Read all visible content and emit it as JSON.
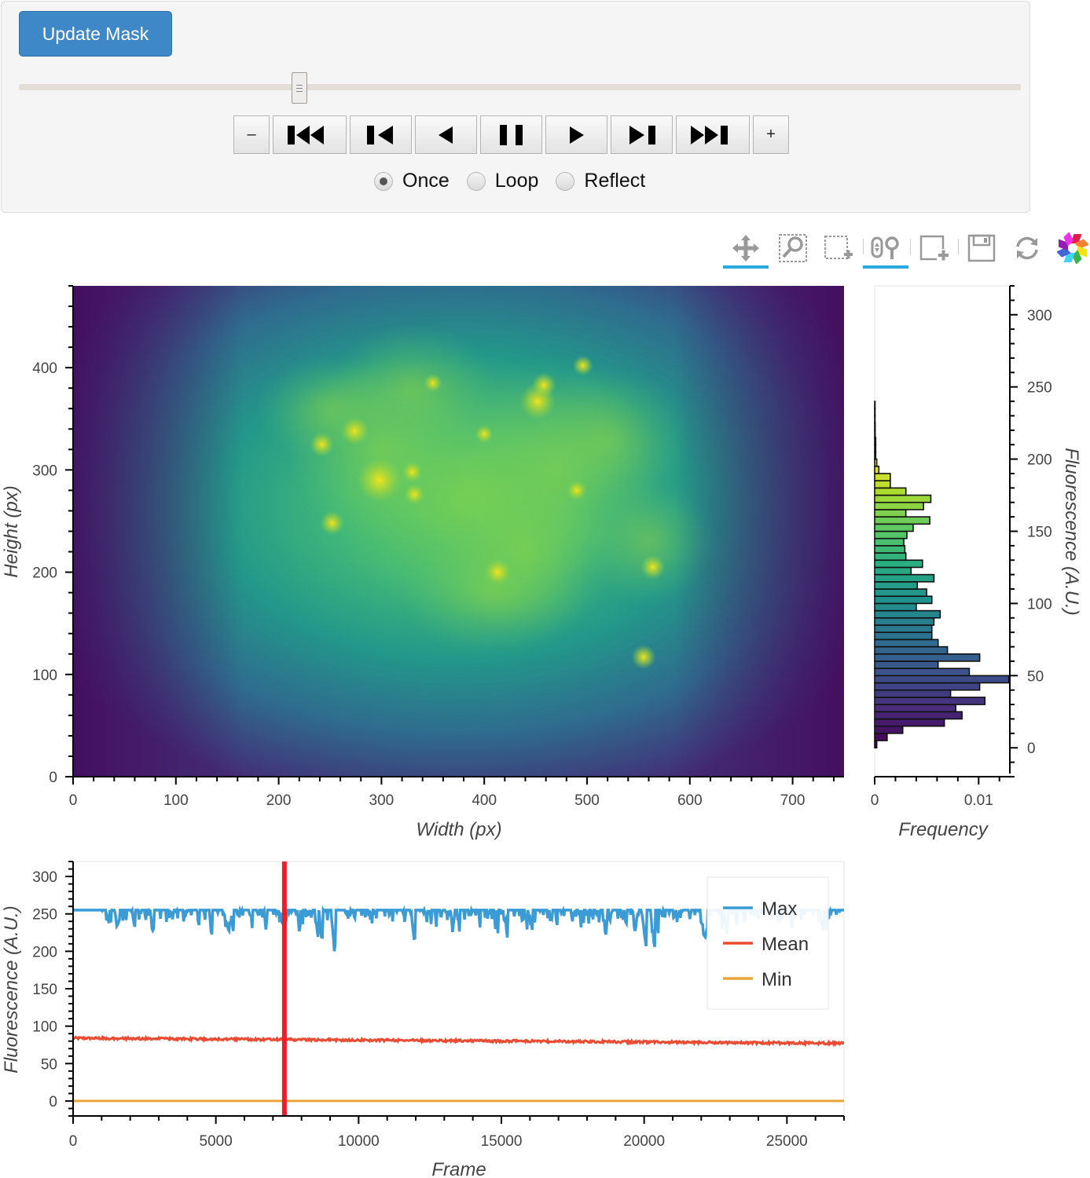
{
  "controls": {
    "update_mask_label": "Update Mask",
    "slider": {
      "value_fraction": 0.28
    },
    "player_buttons": [
      {
        "name": "slower-button",
        "icon": "minus-icon",
        "label": "–"
      },
      {
        "name": "first-frame-button",
        "icon": "skip-to-start-icon"
      },
      {
        "name": "previous-frame-button",
        "icon": "step-backward-icon"
      },
      {
        "name": "play-reverse-button",
        "icon": "play-reverse-icon"
      },
      {
        "name": "pause-button",
        "icon": "pause-icon"
      },
      {
        "name": "play-button",
        "icon": "play-icon"
      },
      {
        "name": "next-frame-button",
        "icon": "step-forward-icon"
      },
      {
        "name": "last-frame-button",
        "icon": "skip-to-end-icon"
      },
      {
        "name": "faster-button",
        "icon": "plus-icon",
        "label": "+"
      }
    ],
    "loop_modes": [
      {
        "label": "Once",
        "selected": true
      },
      {
        "label": "Loop",
        "selected": false
      },
      {
        "label": "Reflect",
        "selected": false
      }
    ]
  },
  "toolbar": {
    "tools": [
      {
        "name": "pan-tool",
        "icon": "move-icon",
        "active": true
      },
      {
        "name": "box-zoom-tool",
        "icon": "box-zoom-icon",
        "active": false
      },
      {
        "name": "box-select-tool",
        "icon": "box-select-icon",
        "active": false
      },
      {
        "name": "wheel-zoom-tool",
        "icon": "wheel-zoom-icon",
        "active": true
      },
      {
        "name": "box-edit-tool",
        "icon": "box-edit-icon",
        "active": false
      },
      {
        "name": "save-tool",
        "icon": "save-icon",
        "active": false
      },
      {
        "name": "reset-tool",
        "icon": "reset-icon",
        "active": false
      },
      {
        "name": "bokeh-logo",
        "icon": "bokeh-logo-icon",
        "active": false
      }
    ]
  },
  "chart_data": [
    {
      "type": "heatmap",
      "title": "",
      "xlabel": "Width (px)",
      "ylabel": "Height (px)",
      "xlim": [
        0,
        750
      ],
      "ylim": [
        0,
        480
      ],
      "xticks": [
        "0",
        "100",
        "200",
        "300",
        "400",
        "500",
        "600",
        "700"
      ],
      "yticks": [
        "0",
        "100",
        "200",
        "300",
        "400"
      ],
      "colormap": "viridis",
      "description": "Fluorescence image of a cell, bright spots concentrated in center"
    },
    {
      "type": "bar",
      "orientation": "horizontal",
      "xlabel": "Frequency",
      "ylabel": "Fluorescence (A.U.)",
      "xlim": [
        0,
        0.013
      ],
      "ylim": [
        -20,
        320
      ],
      "xticks": [
        "0",
        "0.01"
      ],
      "yticks": [
        "0",
        "50",
        "100",
        "150",
        "200",
        "250",
        "300"
      ],
      "bin_width": 5,
      "bin_starts": [
        0,
        5,
        10,
        15,
        20,
        25,
        30,
        35,
        40,
        45,
        50,
        55,
        60,
        65,
        70,
        75,
        80,
        85,
        90,
        95,
        100,
        105,
        110,
        115,
        120,
        125,
        130,
        135,
        140,
        145,
        150,
        155,
        160,
        165,
        170,
        175,
        180,
        185,
        190,
        195,
        200,
        205,
        210,
        215,
        220,
        225,
        230,
        235
      ],
      "values": [
        0.0002,
        0.0012,
        0.0027,
        0.0067,
        0.0084,
        0.0078,
        0.0106,
        0.0073,
        0.0101,
        0.0129,
        0.0091,
        0.0061,
        0.0101,
        0.007,
        0.0061,
        0.0055,
        0.0055,
        0.0057,
        0.0063,
        0.004,
        0.0055,
        0.005,
        0.0041,
        0.0057,
        0.0035,
        0.0046,
        0.003,
        0.0029,
        0.0028,
        0.0031,
        0.0037,
        0.0053,
        0.003,
        0.0047,
        0.0054,
        0.003,
        0.0015,
        0.0015,
        0.0004,
        0.0002,
        0.0001,
        0.0001,
        0.0001,
        5e-05,
        5e-05,
        3e-05,
        2e-05,
        1e-05
      ]
    },
    {
      "type": "line",
      "xlabel": "Frame",
      "ylabel": "Fluorescence (A.U.)",
      "xlim": [
        0,
        27000
      ],
      "ylim": [
        -20,
        320
      ],
      "xticks": [
        "0",
        "5000",
        "10000",
        "15000",
        "20000",
        "25000"
      ],
      "yticks": [
        "0",
        "50",
        "100",
        "150",
        "200",
        "250",
        "300"
      ],
      "current_frame_marker": 7400,
      "legend": {
        "placement": "top-right",
        "entries": [
          "Max",
          "Mean",
          "Min"
        ]
      },
      "series": [
        {
          "name": "Max",
          "color": "#3a9bd5",
          "description": "saturates at 255, fluctuates 190-255",
          "base": 255,
          "min": 190
        },
        {
          "name": "Mean",
          "color": "#ea4b32",
          "description": "about 80, slowly declining from ~84 to ~77",
          "start": 84,
          "end": 77
        },
        {
          "name": "Min",
          "color": "#e8a53a",
          "constant": 0
        }
      ]
    }
  ],
  "colors": {
    "accent_button": "#3f88c8",
    "active_tool": "#26aae1",
    "frame_marker": "#ee1c24"
  }
}
